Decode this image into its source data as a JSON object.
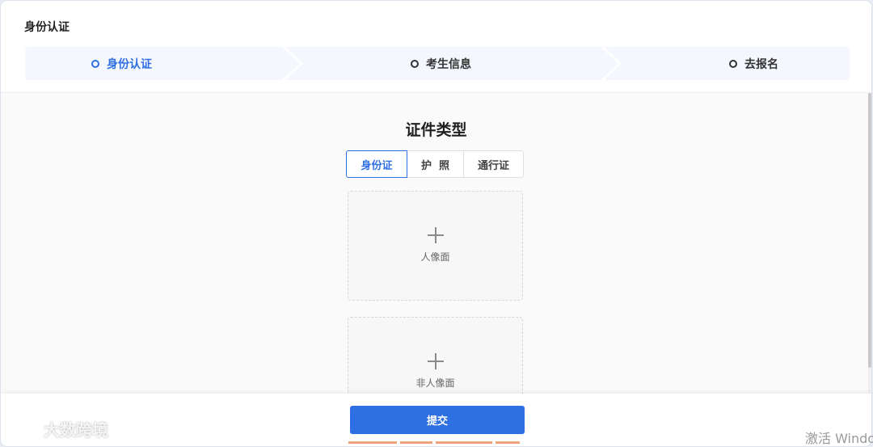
{
  "page": {
    "title": "身份认证"
  },
  "steps": [
    {
      "label": "身份认证",
      "active": true
    },
    {
      "label": "考生信息",
      "active": false
    },
    {
      "label": "去报名",
      "active": false
    }
  ],
  "main": {
    "section_title": "证件类型",
    "doc_types": [
      {
        "label": "身份证",
        "active": true
      },
      {
        "label": "护  照",
        "active": false
      },
      {
        "label": "通行证",
        "active": false
      }
    ],
    "uploads": [
      {
        "label": "人像面",
        "icon": "plus-icon"
      },
      {
        "label": "非人像面",
        "icon": "plus-icon"
      }
    ]
  },
  "footer": {
    "submit_label": "提交"
  },
  "watermark": {
    "text": "大数跨境"
  },
  "os_overlay": {
    "activate_text": "激活 Windows"
  },
  "colors": {
    "accent": "#2f6fe4",
    "step_bar_bg": "#f4f7fd"
  }
}
